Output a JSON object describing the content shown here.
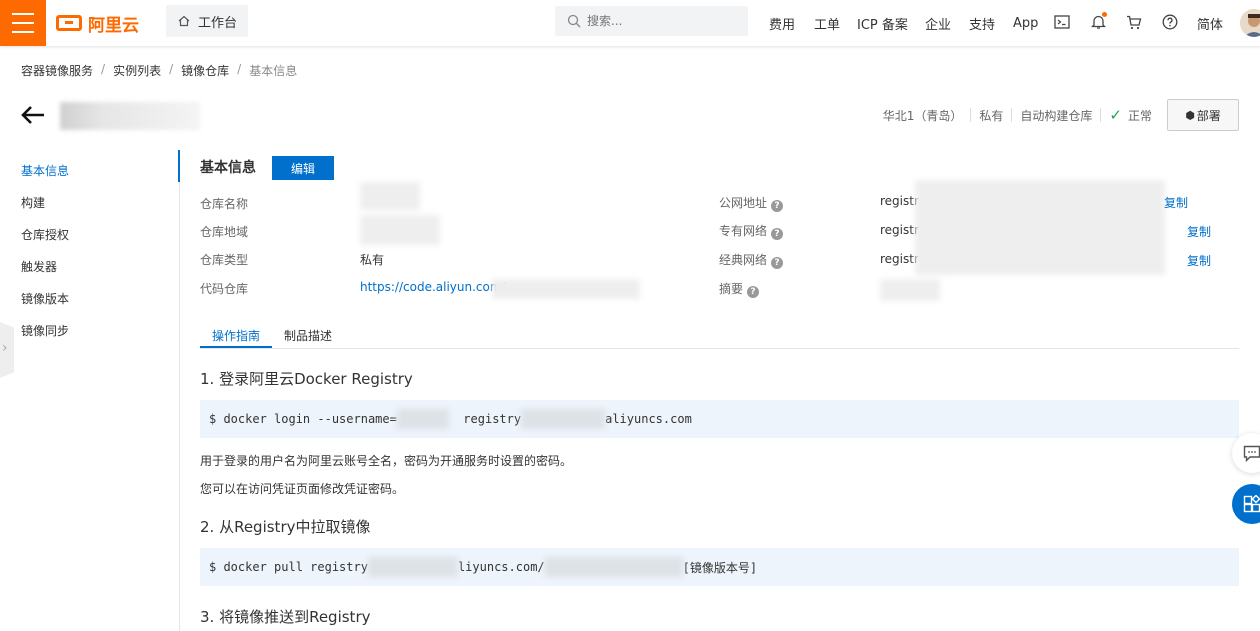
{
  "topbar": {
    "brand": "阿里云",
    "workbench_label": "工作台",
    "search_placeholder": "搜索...",
    "nav_items": [
      "费用",
      "工单",
      "ICP 备案",
      "企业",
      "支持",
      "App"
    ],
    "lang_label": "简体"
  },
  "breadcrumb": [
    "容器镜像服务",
    "实例列表",
    "镜像仓库",
    "基本信息"
  ],
  "header": {
    "region": "华北1（青岛）",
    "visibility": "私有",
    "build_type": "自动构建仓库",
    "status": "正常",
    "deploy_label": "部署"
  },
  "sidebar": {
    "items": [
      "基本信息",
      "构建",
      "仓库授权",
      "触发器",
      "镜像版本",
      "镜像同步"
    ]
  },
  "info": {
    "title": "基本信息",
    "edit_label": "编辑",
    "labels": {
      "name": "仓库名称",
      "region": "仓库地域",
      "type": "仓库类型",
      "code": "代码仓库",
      "public": "公网地址",
      "vpc": "专有网络",
      "classic": "经典网络",
      "digest": "摘要"
    },
    "type_value": "私有",
    "code_value": "https://code.aliyun.com/",
    "public_value": "registr",
    "vpc_value": "registr",
    "classic_value": "registr",
    "copy_label": "复制"
  },
  "tabs": [
    "操作指南",
    "制品描述"
  ],
  "guide": {
    "step1_title": "1. 登录阿里云Docker Registry",
    "step1_code_a": "$ docker login --username=",
    "step1_code_b": "registry",
    "step1_code_c": "aliyuncs.com",
    "step1_desc1": "用于登录的用户名为阿里云账号全名，密码为开通服务时设置的密码。",
    "step1_desc2": "您可以在访问凭证页面修改凭证密码。",
    "step2_title": "2. 从Registry中拉取镜像",
    "step2_code_a": "$ docker pull registry",
    "step2_code_b": "liyuncs.com/",
    "step2_code_c": "[镜像版本号]",
    "step3_title": "3. 将镜像推送到Registry"
  },
  "colors": {
    "brand": "#ff6a00",
    "primary": "#0070cc",
    "ok": "#22a24d"
  }
}
